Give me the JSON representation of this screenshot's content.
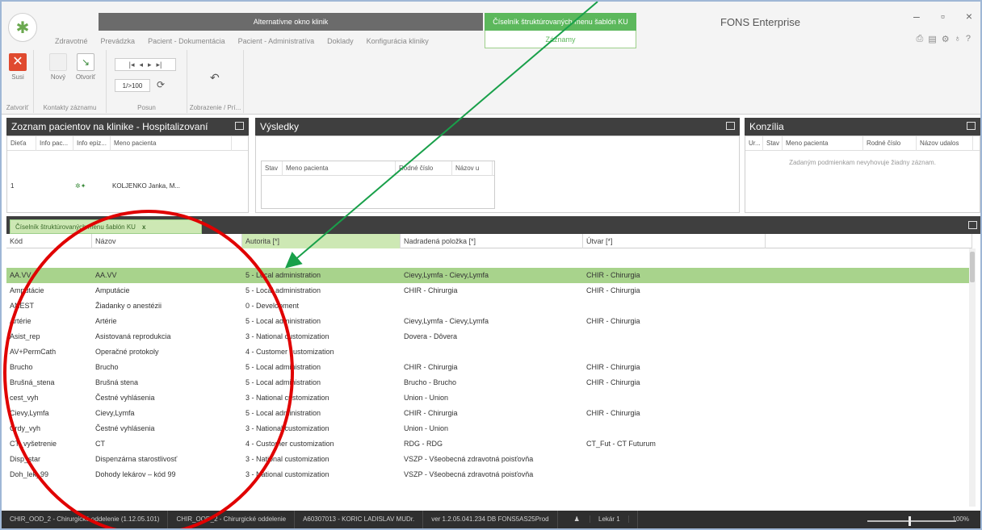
{
  "ribbon": {
    "context_group_left": "Alternatívne okno klinik",
    "context_group_right": "Číselník štruktúrovaných menu šablón KU",
    "context_tab_right": "Záznamy",
    "tabs": [
      "Zdravotné",
      "Prevádzka",
      "Pacient - Dokumentácia",
      "Pacient - Administratíva",
      "Doklady",
      "Konfigurácia kliniky"
    ],
    "app_title": "FONS Enterprise",
    "buttons": {
      "close": "Susi",
      "new": "Nový",
      "open": "Otvoriť"
    },
    "page_counter": "1/>100",
    "groups": [
      "Zatvoriť",
      "Kontakty záznamu",
      "Posun",
      "Zobrazenie / Prí..."
    ]
  },
  "panels": {
    "patients": {
      "title": "Zoznam pacientov na klinike - Hospitalizovaní",
      "columns": [
        "Dieťa",
        "Info pac...",
        "Info epiz...",
        "Meno pacienta"
      ],
      "row": {
        "index": "1",
        "name": "KOLJENKO Janka, M..."
      }
    },
    "results": {
      "title": "Výsledky",
      "columns": [
        "Stav",
        "Meno pacienta",
        "Rodné číslo",
        "Názov u"
      ]
    },
    "konzilia": {
      "title": "Konzília",
      "columns": [
        "Ur...",
        "Stav",
        "Meno pacienta",
        "Rodné číslo",
        "Názov udalos"
      ],
      "empty": "Zadaným podmienkam nevyhovuje žiadny záznam."
    }
  },
  "doc_tab": {
    "label": "Číselník štruktúrovaných menu šablón KU",
    "close": "x"
  },
  "grid": {
    "columns": [
      "Kód",
      "Názov",
      "Autorita [*]",
      "Nadradená položka [*]",
      "Útvar [*]",
      ""
    ],
    "rows": [
      {
        "kod": "AA.VV",
        "nazov": "AA.VV",
        "autorita": "5 - Local administration",
        "nadradena": "Cievy,Lymfa - Cievy,Lymfa",
        "utvar": "CHIR - Chirurgia",
        "sel": true
      },
      {
        "kod": "Amputácie",
        "nazov": "Amputácie",
        "autorita": "5 - Local administration",
        "nadradena": "CHIR - Chirurgia",
        "utvar": "CHIR - Chirurgia"
      },
      {
        "kod": "ANEST",
        "nazov": "Žiadanky o anestézii",
        "autorita": "0 - Development",
        "nadradena": "",
        "utvar": ""
      },
      {
        "kod": "Artérie",
        "nazov": "Artérie",
        "autorita": "5 - Local administration",
        "nadradena": "Cievy,Lymfa - Cievy,Lymfa",
        "utvar": "CHIR - Chirurgia"
      },
      {
        "kod": "Asist_rep",
        "nazov": "Asistovaná reprodukcia",
        "autorita": "3 - National customization",
        "nadradena": "Dovera - Dôvera",
        "utvar": ""
      },
      {
        "kod": "AV+PermCath",
        "nazov": "Operačné protokoly",
        "autorita": "4 - Customer customization",
        "nadradena": "",
        "utvar": ""
      },
      {
        "kod": "Brucho",
        "nazov": "Brucho",
        "autorita": "5 - Local administration",
        "nadradena": "CHIR - Chirurgia",
        "utvar": "CHIR - Chirurgia"
      },
      {
        "kod": "Brušná_stena",
        "nazov": "Brušná stena",
        "autorita": "5 - Local administration",
        "nadradena": "Brucho - Brucho",
        "utvar": "CHIR - Chirurgia"
      },
      {
        "kod": "cest_vyh",
        "nazov": "Čestné vyhlásenia",
        "autorita": "3 - National customization",
        "nadradena": "Union - Union",
        "utvar": ""
      },
      {
        "kod": "Cievy,Lymfa",
        "nazov": "Cievy,Lymfa",
        "autorita": "5 - Local administration",
        "nadradena": "CHIR - Chirurgia",
        "utvar": "CHIR - Chirurgia"
      },
      {
        "kod": "Crdy_vyh",
        "nazov": "Čestné vyhlásenia",
        "autorita": "3 - National customization",
        "nadradena": "Union - Union",
        "utvar": ""
      },
      {
        "kod": "CT_vyšetrenie",
        "nazov": "CT",
        "autorita": "4 - Customer customization",
        "nadradena": "RDG - RDG",
        "utvar": "CT_Fut - CT Futurum"
      },
      {
        "kod": "Disp_star",
        "nazov": "Dispenzárna starostlivosť",
        "autorita": "3 - National customization",
        "nadradena": "VSZP - Všeobecná zdravotná poisťovňa",
        "utvar": ""
      },
      {
        "kod": "Doh_lek_99",
        "nazov": "Dohody lekárov – kód 99",
        "autorita": "3 - National customization",
        "nadradena": "VSZP - Všeobecná zdravotná poisťovňa",
        "utvar": ""
      }
    ]
  },
  "status": {
    "s1": "CHIR_OOD_2 - Chirurgické oddelenie (1.12.05.101)",
    "s2": "CHIR_OOD_2 - Chirurgické oddelenie",
    "s3": "A60307013 - KORIC LADISLAV MUDr.",
    "s4": "ver 1.2.05.041.234 DB FONS5AS25Prod",
    "s5": "Lekár 1",
    "zoom": "100%"
  },
  "colors": {
    "selection": "#a8d38c",
    "dark_header": "#3f3f3f",
    "accent_green": "#5cb85c",
    "annotation_red": "#e00000",
    "annotation_arrow": "#19a04a"
  },
  "icons": [
    "fons-logo-icon",
    "close-icon",
    "new-icon",
    "open-icon",
    "first-page-icon",
    "prev-page-icon",
    "next-page-icon",
    "last-page-icon",
    "refresh-icon",
    "undo-icon",
    "maximize-icon",
    "user-icon"
  ]
}
